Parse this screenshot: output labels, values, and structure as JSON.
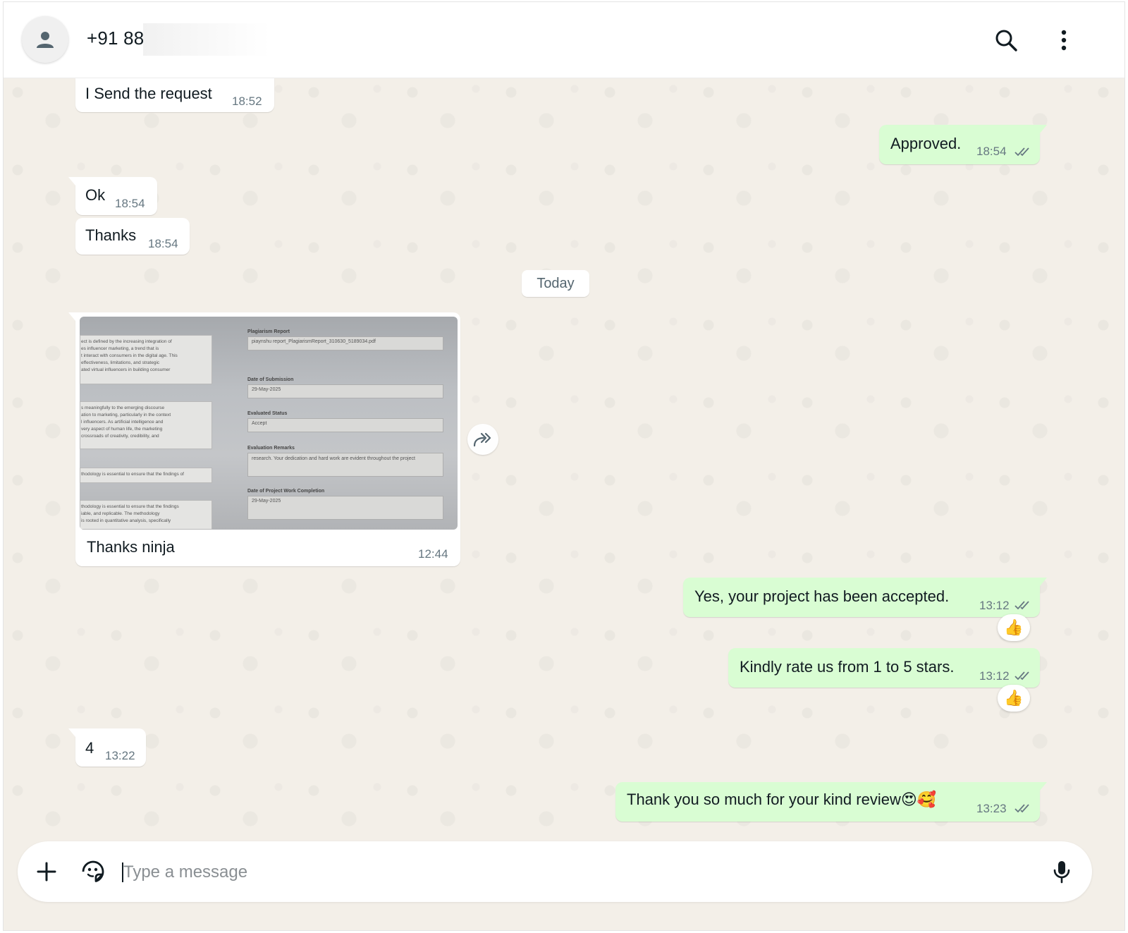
{
  "header": {
    "contact_name": "+91 88",
    "icons": [
      "person-icon",
      "search-icon",
      "more-vertical-icon"
    ]
  },
  "messages": [
    {
      "dir": "in",
      "text": "I Send the request",
      "time": "18:52"
    },
    {
      "dir": "out",
      "text": "Approved.",
      "time": "18:54",
      "status": "read"
    },
    {
      "dir": "in",
      "text": "Ok",
      "time": "18:54"
    },
    {
      "dir": "in",
      "text": "Thanks",
      "time": "18:54"
    },
    {
      "dir": "in",
      "type": "image",
      "caption": "Thanks ninja",
      "time": "12:44"
    },
    {
      "dir": "out",
      "text": "Yes, your project has been accepted.",
      "time": "13:12",
      "status": "read",
      "reaction": "👍"
    },
    {
      "dir": "out",
      "text": "Kindly rate us from 1 to 5 stars.",
      "time": "13:12",
      "status": "read",
      "reaction": "👍"
    },
    {
      "dir": "in",
      "text": "4",
      "time": "13:22"
    },
    {
      "dir": "out",
      "text": "Thank you so much for your kind review😍🥰",
      "time": "13:23",
      "status": "read"
    }
  ],
  "day_separator": "Today",
  "photo": {
    "left_lines": [
      "ect is defined by the increasing integration of",
      "es influencer marketing, a trend that is",
      "t interact with consumers in the digital age. This",
      "effectiveness, limitations, and strategic",
      "ated virtual influencers in building consumer",
      "s meaningfully to the emerging discourse",
      "ation to marketing, particularly in the context",
      "l influencers. As artificial intelligence and",
      "very aspect of human life, the marketing",
      "crossroads of creativity, credibility, and",
      "thodology is essential to ensure that the findings of",
      "thodology is essential to ensure that the findings",
      "iable, and replicable. The methodology",
      "is rooted in quantitative analysis, specifically"
    ],
    "labels": {
      "plagiarism": "Plagiarism Report",
      "submission": "Date of Submission",
      "status": "Evaluated Status",
      "remarks": "Evaluation Remarks",
      "completion": "Date of Project Work Completion"
    },
    "values": {
      "plagiarism": "piaynshu report_PlagiarismReport_310630_5189034.pdf",
      "submission": "29-May-2025",
      "status": "Accept",
      "remarks": "research. Your dedication and hard work are evident throughout the project",
      "completion": "29-May-2025"
    }
  },
  "composer": {
    "placeholder": "Type a message"
  },
  "colors": {
    "outgoing_bubble": "#d9fdd3",
    "incoming_bubble": "#ffffff",
    "wallpaper": "#f3efe8",
    "read_ticks": "#667781"
  }
}
